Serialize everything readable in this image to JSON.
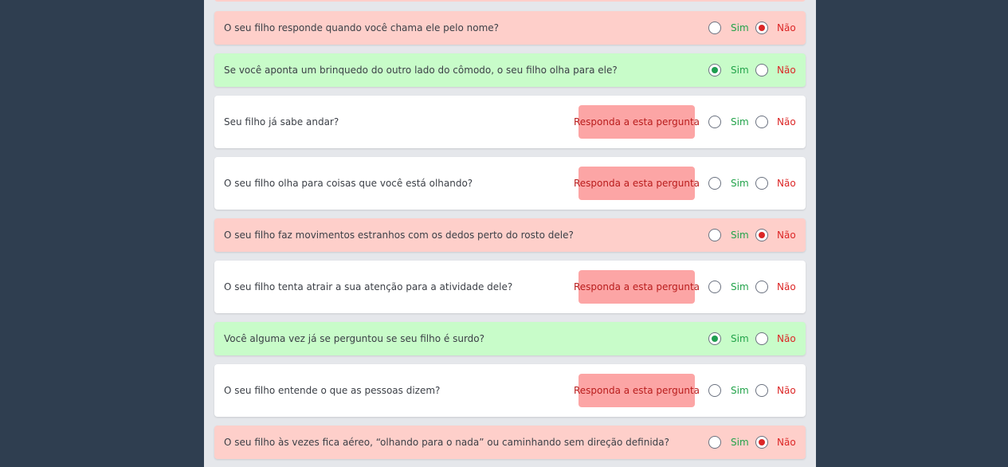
{
  "options": {
    "yes_label": "Sim",
    "no_label": "Não"
  },
  "warning_label": "Responda a esta pergunta",
  "questions": [
    {
      "text": "O seu filho responde quando você chama ele pelo nome?",
      "answer": "no"
    },
    {
      "text": "Se você aponta um brinquedo do outro lado do cômodo, o seu filho olha para ele?",
      "answer": "yes"
    },
    {
      "text": "Seu filho já sabe andar?",
      "answer": "none"
    },
    {
      "text": "O seu filho olha para coisas que você está olhando?",
      "answer": "none"
    },
    {
      "text": "O seu filho faz movimentos estranhos com os dedos perto do rosto dele?",
      "answer": "no"
    },
    {
      "text": "O seu filho tenta atrair a sua atenção para a atividade dele?",
      "answer": "none"
    },
    {
      "text": "Você alguma vez já se perguntou se seu filho é surdo?",
      "answer": "yes"
    },
    {
      "text": "O seu filho entende o que as pessoas dizem?",
      "answer": "none"
    },
    {
      "text": "O seu filho às vezes fica aéreo, “olhando para o nada” ou caminhando sem direção definida?",
      "answer": "no"
    }
  ]
}
